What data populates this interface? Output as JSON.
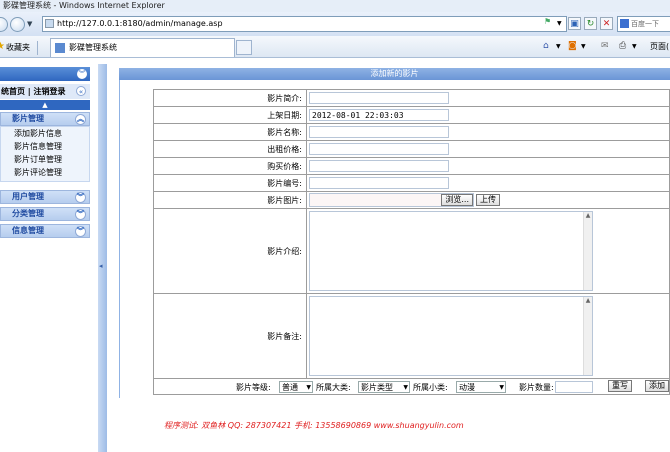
{
  "window": {
    "title": "影碟管理系统 - Windows Internet Explorer"
  },
  "browser": {
    "address": "http://127.0.0.1:8180/admin/manage.asp",
    "search_placeholder": "百度一下",
    "favorites_label": "收藏夹",
    "tab_title": "影碟管理系统",
    "page_menu_label": "页面("
  },
  "sidebar": {
    "top_links": "统首页 | 注销登录",
    "sections": [
      {
        "label": "影片管理",
        "items": [
          "添加影片信息",
          "影片信息管理",
          "影片订单管理",
          "影片评论管理"
        ]
      },
      {
        "label": "用户管理"
      },
      {
        "label": "分类管理"
      },
      {
        "label": "信息管理"
      }
    ]
  },
  "main": {
    "header": "添加新的影片",
    "fields": {
      "intro_label": "影片简介:",
      "date_label": "上架日期:",
      "date_value": "2012-08-01 22:03:03",
      "name_label": "影片名称:",
      "rent_label": "出租价格:",
      "buy_label": "购买价格:",
      "code_label": "影片编号:",
      "image_label": "影片图片:",
      "browse_button": "浏览...",
      "upload_button": "上传",
      "desc_label": "影片介绍:",
      "note_label": "影片备注:"
    },
    "bottom": {
      "grade_label": "影片等级:",
      "grade_value": "普通",
      "major_label": "所属大类:",
      "major_value": "影片类型",
      "minor_label": "所属小类:",
      "minor_value": "动漫",
      "qty_label": "影片数量:",
      "reset_button": "重写",
      "add_button": "添加"
    }
  },
  "footer": "程序测试: 双鱼林  QQ: 287307421  手机: 13558690869  www.shuangyulin.com"
}
